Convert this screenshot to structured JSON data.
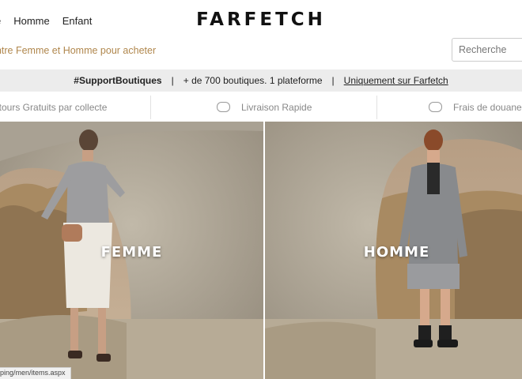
{
  "header": {
    "nav": [
      "e",
      "Homme",
      "Enfant"
    ],
    "logo": "FARFETCH",
    "promo": "entre Femme et Homme pour acheter",
    "search_placeholder": "Recherche"
  },
  "banner": {
    "hashtag": "#SupportBoutiques",
    "divider": "|",
    "text": "+ de 700 boutiques. 1 plateforme",
    "link": "Uniquement sur Farfetch"
  },
  "services": [
    {
      "label": "etours Gratuits par collecte",
      "icon": "return-icon"
    },
    {
      "label": "Livraison Rapide",
      "icon": "clock-icon"
    },
    {
      "label": "Frais de douanes",
      "icon": "customs-icon"
    }
  ],
  "heroes": {
    "left_label": "FEMME",
    "right_label": "HOMME"
  },
  "status_url": "ping/men/items.aspx"
}
